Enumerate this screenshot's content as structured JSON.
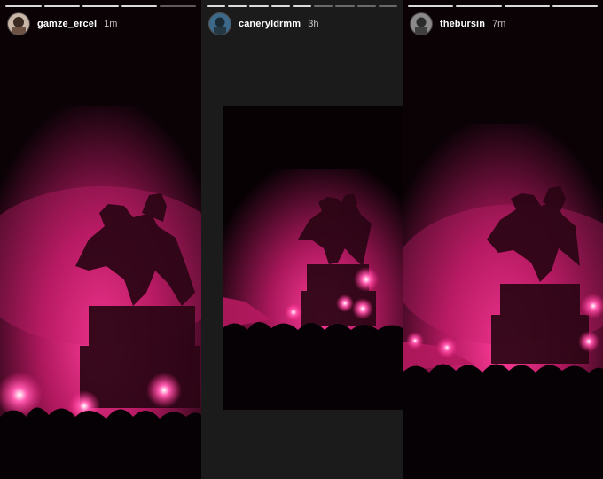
{
  "stories": [
    {
      "username": "gamze_ercel",
      "time": "1m",
      "avatar_icon": "profile-photo-icon",
      "progress": [
        1,
        1,
        1,
        1,
        0
      ]
    },
    {
      "username": "caneryldrmm",
      "time": "3h",
      "avatar_icon": "profile-photo-icon",
      "progress": [
        1,
        1,
        1,
        1,
        1,
        0,
        0,
        0,
        0
      ]
    },
    {
      "username": "thebursin",
      "time": "7m",
      "avatar_icon": "profile-photo-icon",
      "progress": [
        1,
        1,
        1,
        1
      ]
    }
  ],
  "colors": {
    "flare_pink": "#ff2a8c",
    "smoke_magenta": "#b0185e",
    "night": "#0b0206",
    "panel_gray": "#1b1b1b"
  }
}
